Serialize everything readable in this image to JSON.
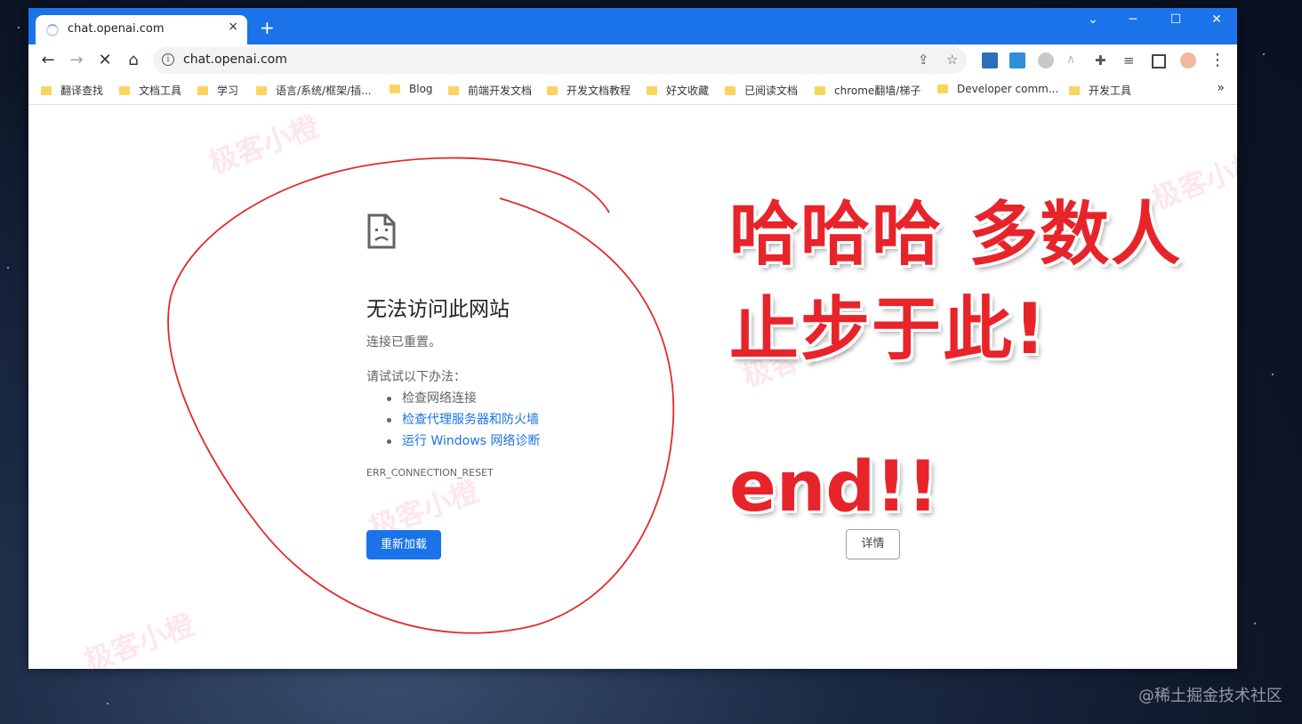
{
  "tab": {
    "title": "chat.openai.com",
    "close": "×"
  },
  "newtab": "+",
  "window_controls": {
    "minimize": "─",
    "maximize": "☐",
    "close": "✕",
    "dropdown": "⌄"
  },
  "nav": {
    "back": "←",
    "forward": "→",
    "stop": "✕",
    "home": "⌂"
  },
  "omnibox": {
    "info": "i",
    "url": "chat.openai.com",
    "share": "⇪",
    "star": "☆"
  },
  "menu": "⋮",
  "bookmarks": [
    "翻译查找",
    "文档工具",
    "学习",
    "语言/系统/框架/插...",
    "Blog",
    "前端开发文档",
    "开发文档教程",
    "好文收藏",
    "已阅读文档",
    "chrome翻墙/梯子",
    "Developer comm...",
    "开发工具"
  ],
  "bookmarks_more": "»",
  "error": {
    "title": "无法访问此网站",
    "subtitle": "连接已重置。",
    "try": "请试试以下办法：",
    "suggestions": [
      "检查网络连接",
      "检查代理服务器和防火墙",
      "运行 Windows 网络诊断"
    ],
    "code": "ERR_CONNECTION_RESET",
    "reload": "重新加载",
    "details": "详情"
  },
  "annotation": {
    "line1": "哈哈哈 多数人",
    "line2": "止步于此!",
    "line3": "end!!"
  },
  "watermark": "极客小橙",
  "credit": "@稀土掘金技术社区",
  "colors": {
    "accent": "#1a73e8",
    "annotation": "#e8242b",
    "link": "#1a73e8"
  }
}
